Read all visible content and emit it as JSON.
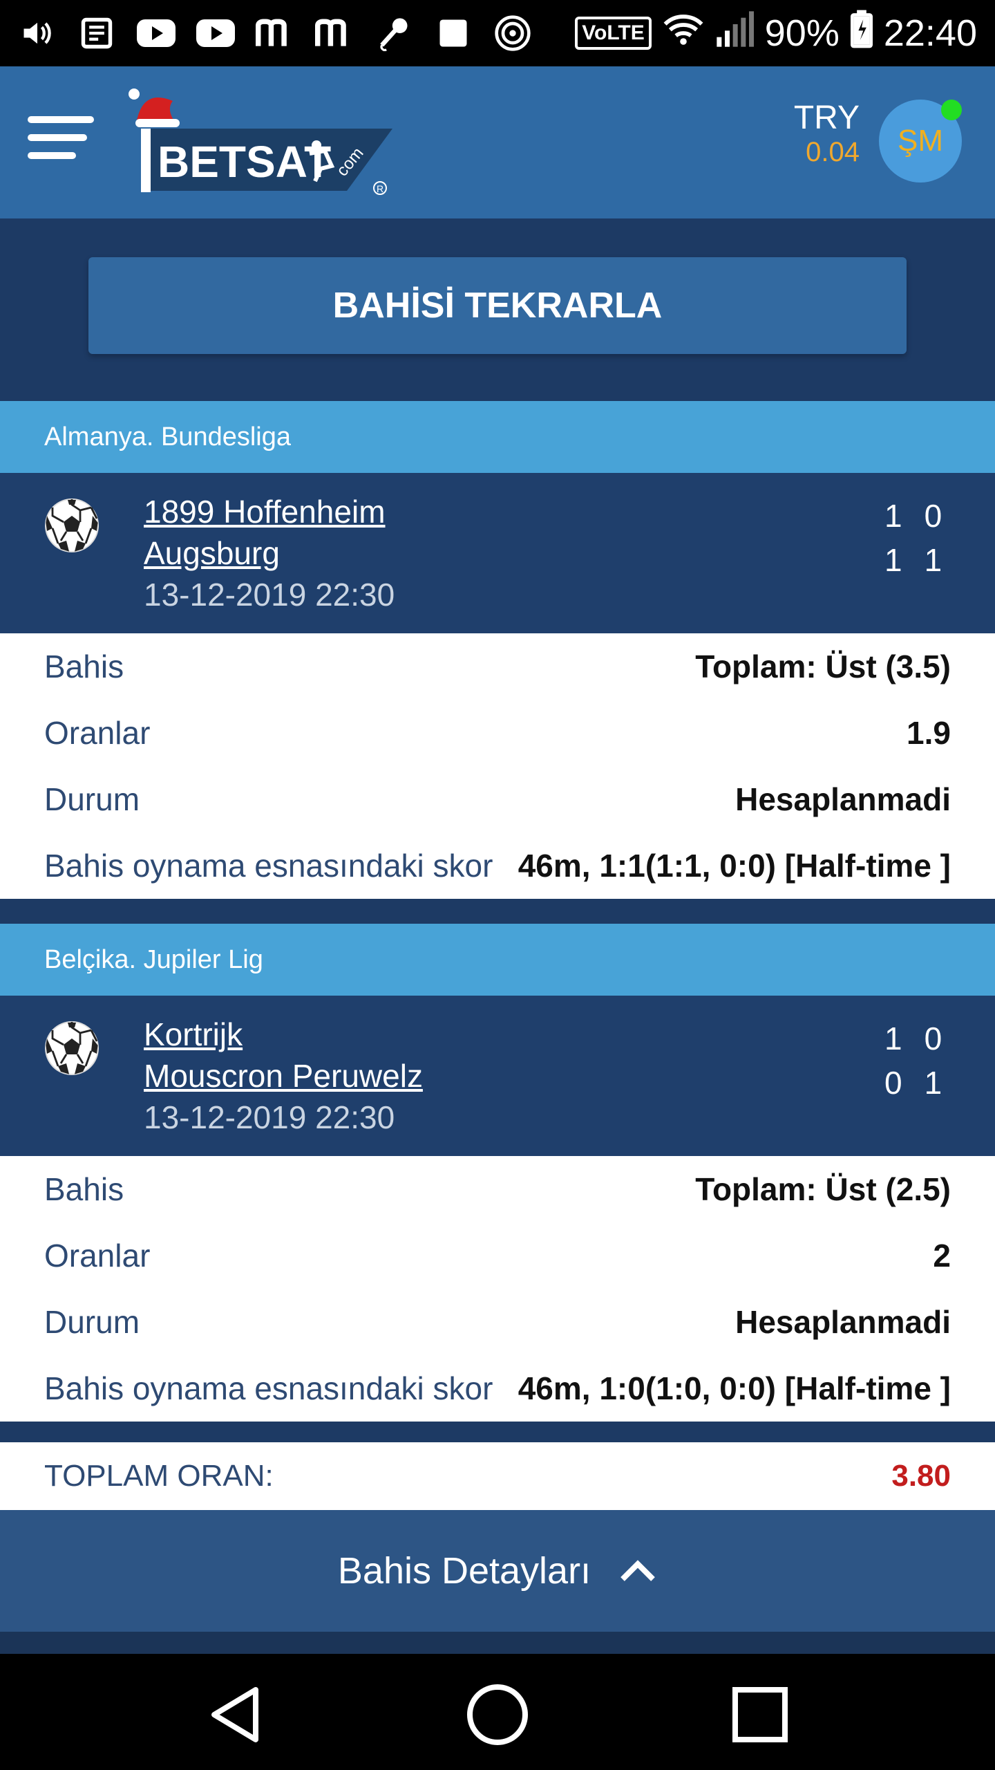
{
  "status_bar": {
    "battery": "90%",
    "time": "22:40",
    "network": "VoLTE",
    "icons": [
      "volume-icon",
      "news-icon",
      "youtube-icon",
      "youtube-icon",
      "m-app-icon",
      "m-app-icon",
      "microphone-icon",
      "square-icon",
      "soccer-ball-icon",
      "wifi-icon",
      "signal-icon",
      "battery-icon"
    ]
  },
  "header": {
    "currency_code": "TRY",
    "balance": "0.04",
    "avatar_initials": "ŞM"
  },
  "repeat_button": "BAHİSİ TEKRARLA",
  "bets": [
    {
      "league": "Almanya. Bundesliga",
      "home": "1899 Hoffenheim",
      "away": "Augsburg",
      "datetime": "13-12-2019 22:30",
      "score_home": [
        "1",
        "0"
      ],
      "score_away": [
        "1",
        "1"
      ],
      "bet_label": "Bahis",
      "bet_value": "Toplam: Üst (3.5)",
      "odds_label": "Oranlar",
      "odds_value": "1.9",
      "status_label": "Durum",
      "status_value": "Hesaplanmadi",
      "score_label": "Bahis oynama esnasındaki skor",
      "score_value": "46m, 1:1(1:1, 0:0) [Half-time ]"
    },
    {
      "league": "Belçika. Jupiler Lig",
      "home": "Kortrijk",
      "away": "Mouscron Peruwelz",
      "datetime": "13-12-2019 22:30",
      "score_home": [
        "1",
        "0"
      ],
      "score_away": [
        "0",
        "1"
      ],
      "bet_label": "Bahis",
      "bet_value": "Toplam: Üst (2.5)",
      "odds_label": "Oranlar",
      "odds_value": "2",
      "status_label": "Durum",
      "status_value": "Hesaplanmadi",
      "score_label": "Bahis oynama esnasındaki skor",
      "score_value": "46m, 1:0(1:0, 0:0) [Half-time ]"
    }
  ],
  "total": {
    "label": "TOPLAM ORAN:",
    "value": "3.80"
  },
  "details_bar": {
    "label": "Bahis Detayları"
  },
  "colors": {
    "header": "#2f6aa4",
    "league_strip": "#48a3d7",
    "match_bg": "#1f3f6c",
    "total_value": "#c21d1d",
    "balance": "#f0a82e"
  }
}
